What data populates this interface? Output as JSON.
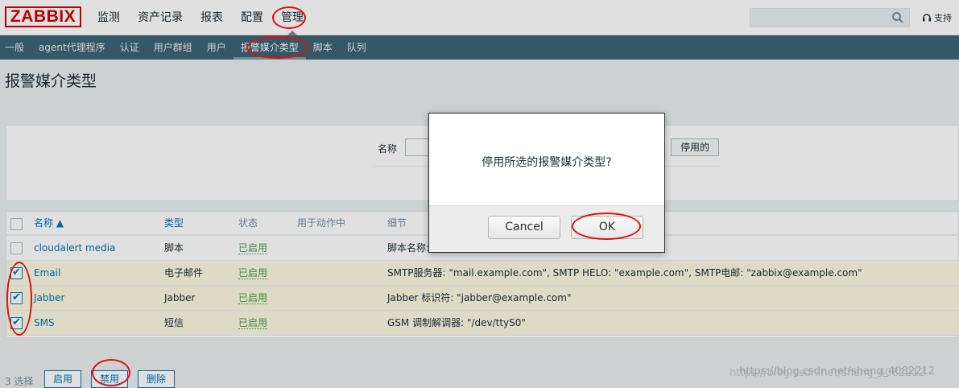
{
  "app": {
    "logo": "ZABBIX"
  },
  "main_nav": [
    "监测",
    "资产记录",
    "报表",
    "配置",
    "管理"
  ],
  "main_nav_active": "管理",
  "search": {
    "placeholder": ""
  },
  "support_label": "支持",
  "sub_nav": [
    "一般",
    "agent代理程序",
    "认证",
    "用户群组",
    "用户",
    "报警媒介类型",
    "脚本",
    "队列"
  ],
  "sub_nav_active": "报警媒介类型",
  "page_title": "报警媒介类型",
  "filter": {
    "name_label": "名称",
    "name_value": "",
    "status_button": "停用的"
  },
  "table": {
    "headers": {
      "name": "名称 ▲",
      "type": "类型",
      "status": "状态",
      "used": "用于动作中",
      "details": "细节"
    },
    "rows": [
      {
        "name": "cloudalert media",
        "type": "脚本",
        "status": "已启用",
        "details": "脚本名称:",
        "checked": false
      },
      {
        "name": "Email",
        "type": "电子邮件",
        "status": "已启用",
        "details": "SMTP服务器: \"mail.example.com\", SMTP HELO: \"example.com\", SMTP电邮: \"zabbix@example.com\"",
        "checked": true
      },
      {
        "name": "Jabber",
        "type": "Jabber",
        "status": "已启用",
        "details": "Jabber 标识符: \"jabber@example.com\"",
        "checked": true
      },
      {
        "name": "SMS",
        "type": "短信",
        "status": "已启用",
        "details": "GSM 调制解调器: \"/dev/ttyS0\"",
        "checked": true
      }
    ]
  },
  "footer": {
    "selected": "3 选择",
    "enable": "启用",
    "disable": "禁用",
    "delete": "删除"
  },
  "dialog": {
    "message": "停用所选的报警媒介类型?",
    "cancel": "Cancel",
    "ok": "OK"
  },
  "watermark": "https://blog.csdn.net/shang_4082212",
  "colors": {
    "brand_red": "#d40000",
    "subnav_bg": "#3d6477",
    "link": "#0275b8",
    "enabled": "#429e47",
    "selected_row": "#fcf9e2",
    "annotation": "#e01010"
  }
}
